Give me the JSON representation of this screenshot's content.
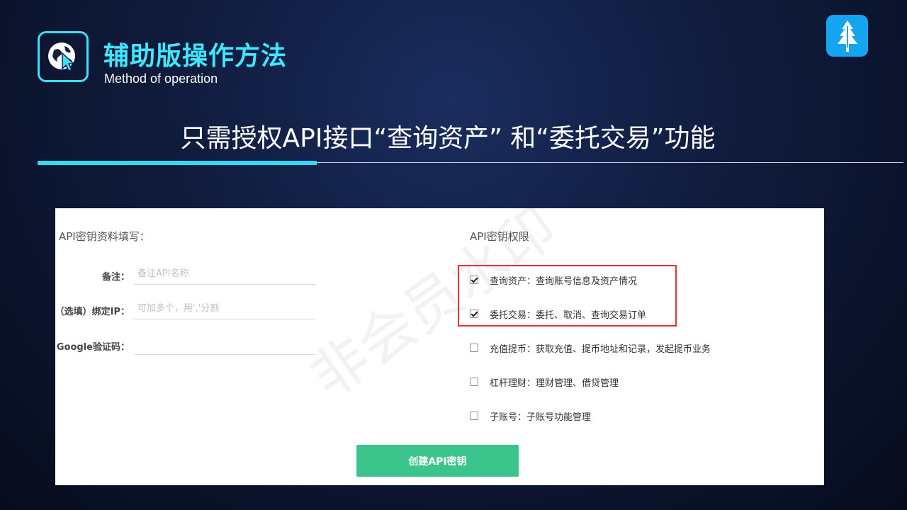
{
  "header": {
    "title": "辅助版操作方法",
    "subtitle_en": "Method of operation"
  },
  "slide": {
    "heading": "只需授权API接口“查询资产” 和“委托交易”功能"
  },
  "form": {
    "section_title": "API密钥资料填写：",
    "fields": [
      {
        "label": "备注：",
        "value": "",
        "placeholder": "备注API名称"
      },
      {
        "label": "（选填）绑定IP：",
        "value": "",
        "placeholder": "可加多个，用','分割"
      },
      {
        "label": "Google验证码：",
        "value": "",
        "placeholder": ""
      }
    ]
  },
  "permissions": {
    "section_title": "API密钥权限",
    "items": [
      {
        "label": "查询资产：查询账号信息及资产情况",
        "checked": true
      },
      {
        "label": "委托交易：委托、取消、查询交易订单",
        "checked": true
      },
      {
        "label": "充值提币：获取充值、提币地址和记录，发起提币业务",
        "checked": false
      },
      {
        "label": "杠杆理财：理财管理、借贷管理",
        "checked": false
      },
      {
        "label": "子账号：子账号功能管理",
        "checked": false
      }
    ]
  },
  "create_button": {
    "label": "创建API密钥"
  },
  "watermark": {
    "text": "非会员水印"
  },
  "icons": {
    "logo": "globe-cursor-icon",
    "badge": "pine-tree-icon"
  },
  "colors": {
    "accent_cyan": "#3fe6ff",
    "button_green": "#3cc48d",
    "highlight_red": "#e63232",
    "badge_blue": "#14a4f0"
  }
}
